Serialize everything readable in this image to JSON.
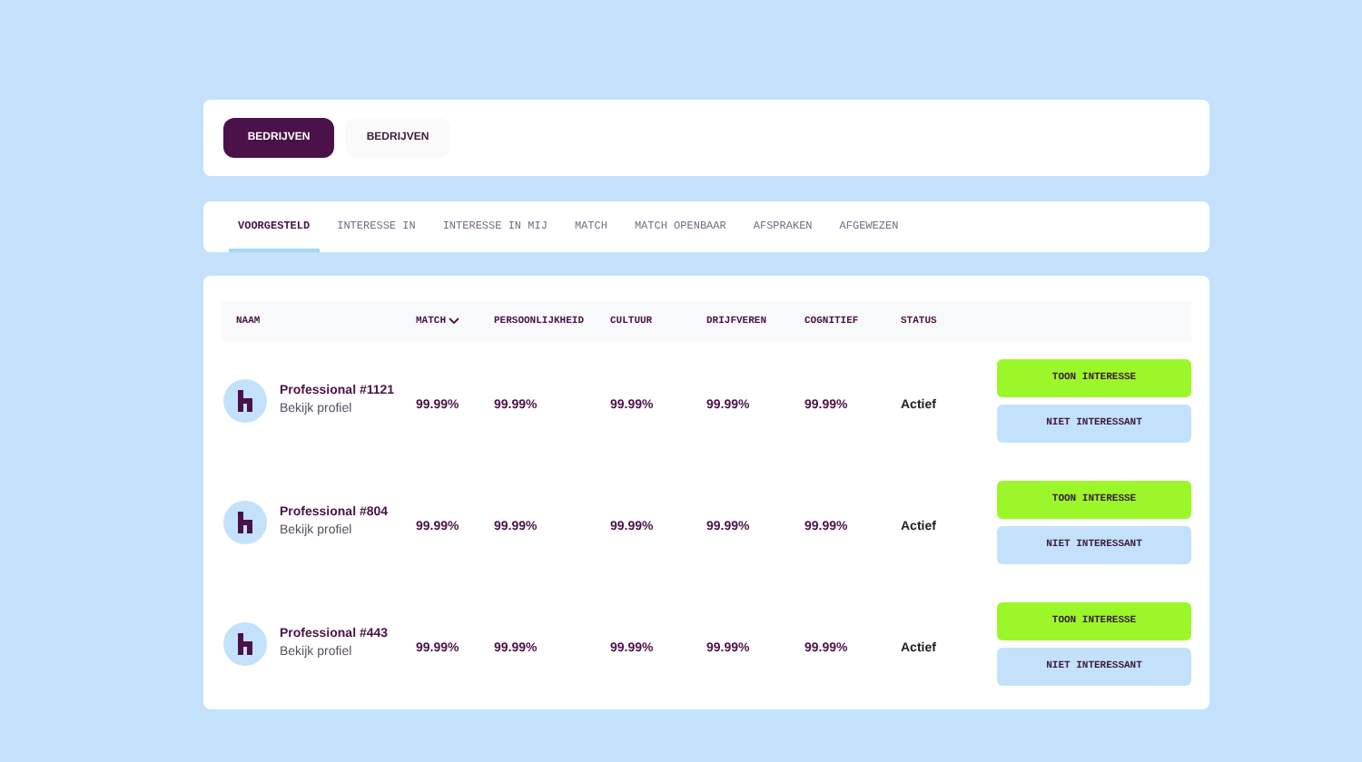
{
  "toggle": [
    {
      "label": "BEDRIJVEN",
      "selected": true
    },
    {
      "label": "BEDRIJVEN",
      "selected": false
    }
  ],
  "tabs": [
    {
      "label": "VOORGESTELD",
      "selected": true
    },
    {
      "label": "INTERESSE IN",
      "selected": false
    },
    {
      "label": "INTERESSE IN MIJ",
      "selected": false
    },
    {
      "label": "MATCH",
      "selected": false
    },
    {
      "label": "MATCH OPENBAAR",
      "selected": false
    },
    {
      "label": "AFSPRAKEN",
      "selected": false
    },
    {
      "label": "AFGEWEZEN",
      "selected": false
    }
  ],
  "table": {
    "columns": [
      {
        "label": "NAAM",
        "sorted": false
      },
      {
        "label": "MATCH",
        "sorted": true
      },
      {
        "label": "PERSOONLIJKHEID",
        "sorted": false
      },
      {
        "label": "CULTUUR",
        "sorted": false
      },
      {
        "label": "DRIJFVEREN",
        "sorted": false
      },
      {
        "label": "COGNITIEF",
        "sorted": false
      },
      {
        "label": "STATUS",
        "sorted": false
      }
    ],
    "rows": [
      {
        "name": "Professional #1121",
        "link": "Bekijk profiel",
        "values": [
          "99.99%",
          "99.99%",
          "99.99%",
          "99.99%",
          "99.99%"
        ],
        "status": "Actief",
        "actions": [
          "TOON INTERESSE",
          "NIET INTERESSANT"
        ]
      },
      {
        "name": "Professional #804",
        "link": "Bekijk profiel",
        "values": [
          "99.99%",
          "99.99%",
          "99.99%",
          "99.99%",
          "99.99%"
        ],
        "status": "Actief",
        "actions": [
          "TOON INTERESSE",
          "NIET INTERESSANT"
        ]
      },
      {
        "name": "Professional #443",
        "link": "Bekijk profiel",
        "values": [
          "99.99%",
          "99.99%",
          "99.99%",
          "99.99%",
          "99.99%"
        ],
        "status": "Actief",
        "actions": [
          "TOON INTERESSE",
          "NIET INTERESSANT"
        ]
      }
    ]
  }
}
